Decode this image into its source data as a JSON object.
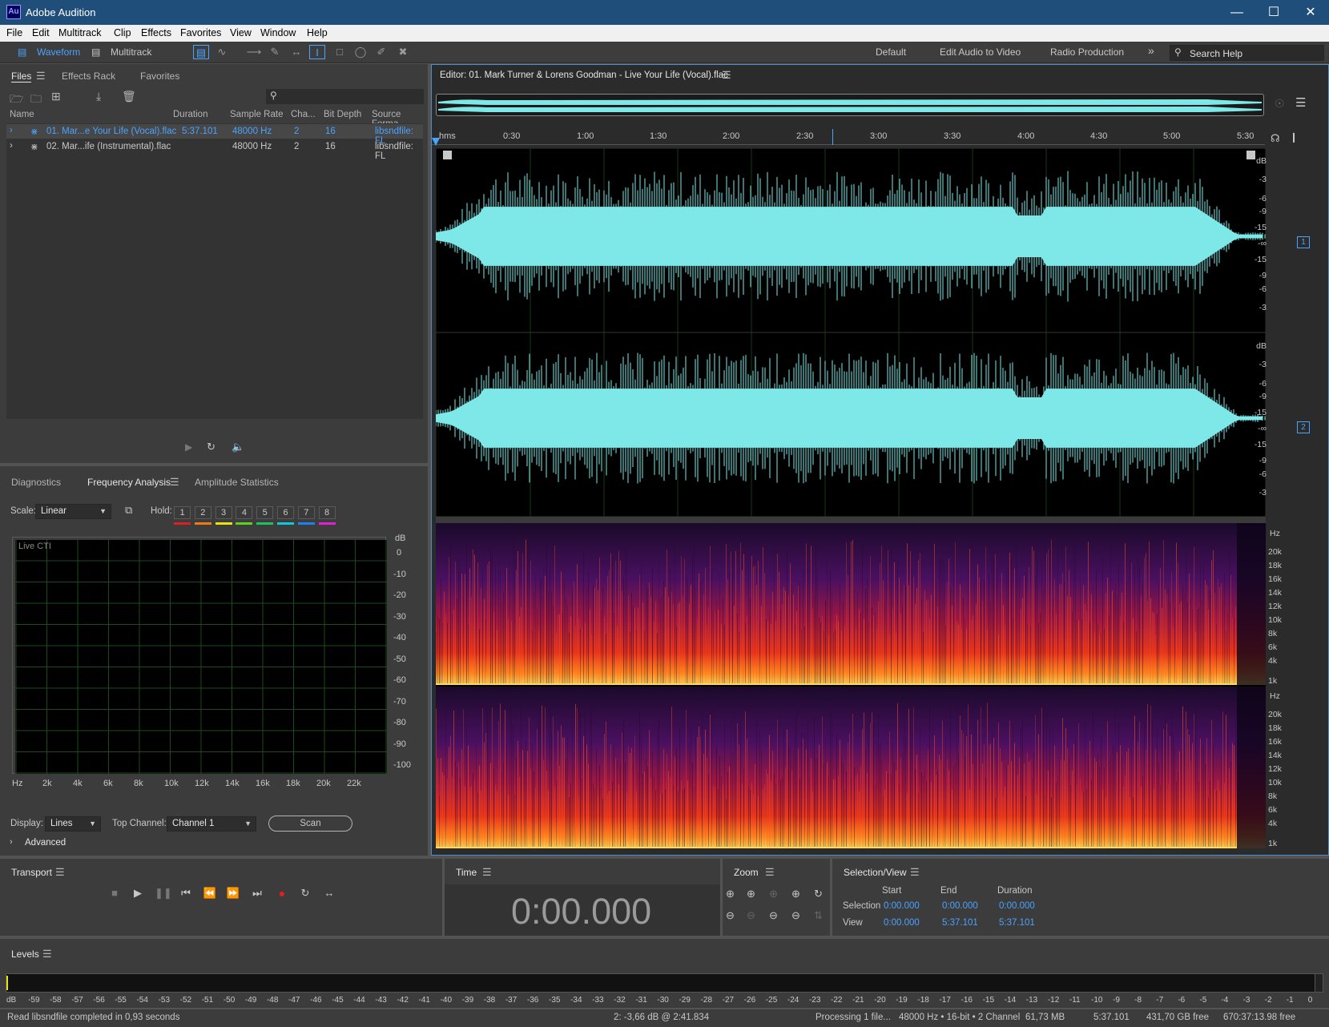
{
  "window": {
    "title": "Adobe Audition",
    "logo": "Au"
  },
  "menu": [
    "File",
    "Edit",
    "Multitrack",
    "Clip",
    "Effects",
    "Favorites",
    "View",
    "Window",
    "Help"
  ],
  "toolbar": {
    "waveform_label": "Waveform",
    "multitrack_label": "Multitrack",
    "workspaces": [
      "Default",
      "Edit Audio to Video",
      "Radio Production"
    ],
    "more": "»",
    "search_placeholder": "Search Help"
  },
  "files_panel": {
    "tabs": [
      "Files",
      "Effects Rack",
      "Favorites"
    ],
    "columns": [
      "Name",
      "Duration",
      "Sample Rate",
      "Cha...",
      "Bit Depth",
      "Source Forma"
    ],
    "rows": [
      {
        "name": "01. Mar...e Your Life (Vocal).flac",
        "duration": "5:37.101",
        "sample_rate": "48000 Hz",
        "channels": "2",
        "bit_depth": "16",
        "source": "libsndfile: FL",
        "selected": true
      },
      {
        "name": "02. Mar...ife (Instrumental).flac",
        "duration": "",
        "sample_rate": "48000 Hz",
        "channels": "2",
        "bit_depth": "16",
        "source": "libsndfile: FL",
        "selected": false
      }
    ]
  },
  "analysis_panel": {
    "tabs": [
      "Diagnostics",
      "Frequency Analysis",
      "Amplitude Statistics"
    ],
    "scale_label": "Scale:",
    "scale_value": "Linear",
    "hold_label": "Hold:",
    "hold_buttons": [
      "1",
      "2",
      "3",
      "4",
      "5",
      "6",
      "7",
      "8"
    ],
    "hold_colors": [
      "#e02020",
      "#f07a10",
      "#e8e010",
      "#60d020",
      "#20c060",
      "#10c8d8",
      "#2080f0",
      "#e020d8"
    ],
    "live_label": "Live CTI",
    "y_unit": "dB",
    "y_ticks": [
      "0",
      "-10",
      "-20",
      "-30",
      "-40",
      "-50",
      "-60",
      "-70",
      "-80",
      "-90",
      "-100"
    ],
    "x_ticks": [
      "Hz",
      "2k",
      "4k",
      "6k",
      "8k",
      "10k",
      "12k",
      "14k",
      "16k",
      "18k",
      "20k",
      "22k"
    ],
    "display_label": "Display:",
    "display_value": "Lines",
    "top_channel_label": "Top Channel:",
    "top_channel_value": "Channel 1",
    "scan_label": "Scan",
    "advanced_label": "Advanced"
  },
  "editor": {
    "title": "Editor: 01. Mark Turner & Lorens Goodman - Live Your Life (Vocal).flac",
    "timeline": [
      "hms",
      "0:30",
      "1:00",
      "1:30",
      "2:00",
      "2:30",
      "3:00",
      "3:30",
      "4:00",
      "4:30",
      "5:00",
      "5:30"
    ],
    "db_ticks_ch": [
      "dB",
      "-3",
      "-6",
      "-9",
      "-15",
      "-∞",
      "-15",
      "-9",
      "-6",
      "-3"
    ],
    "hz_ticks": [
      "Hz",
      "20k",
      "18k",
      "16k",
      "14k",
      "12k",
      "10k",
      "8k",
      "6k",
      "4k",
      "1k"
    ],
    "channels": [
      "1",
      "2"
    ],
    "waveform_color": "#7ee8e8",
    "accent": "#4aa3ff"
  },
  "transport": {
    "title": "Transport"
  },
  "time": {
    "title": "Time",
    "value": "0:00.000"
  },
  "zoom": {
    "title": "Zoom"
  },
  "selection": {
    "title": "Selection/View",
    "headers": [
      "Start",
      "End",
      "Duration"
    ],
    "rows": [
      {
        "label": "Selection",
        "start": "0:00.000",
        "end": "0:00.000",
        "duration": "0:00.000"
      },
      {
        "label": "View",
        "start": "0:00.000",
        "end": "5:37.101",
        "duration": "5:37.101"
      }
    ]
  },
  "levels": {
    "title": "Levels",
    "scale": [
      "dB",
      "-59",
      "-58",
      "-57",
      "-56",
      "-55",
      "-54",
      "-53",
      "-52",
      "-51",
      "-50",
      "-49",
      "-48",
      "-47",
      "-46",
      "-45",
      "-44",
      "-43",
      "-42",
      "-41",
      "-40",
      "-39",
      "-38",
      "-37",
      "-36",
      "-35",
      "-34",
      "-33",
      "-32",
      "-31",
      "-30",
      "-29",
      "-28",
      "-27",
      "-26",
      "-25",
      "-24",
      "-23",
      "-22",
      "-21",
      "-20",
      "-19",
      "-18",
      "-17",
      "-16",
      "-15",
      "-14",
      "-13",
      "-12",
      "-11",
      "-10",
      "-9",
      "-8",
      "-7",
      "-6",
      "-5",
      "-4",
      "-3",
      "-2",
      "-1",
      "0"
    ]
  },
  "status": {
    "message": "Read libsndfile completed in 0,93 seconds",
    "cursor": "2: -3,66 dB @ 2:41.834",
    "processing": "Processing 1 file...",
    "format": "48000 Hz • 16-bit • 2 Channel",
    "size": "61,73 MB",
    "duration": "5:37.101",
    "disk": "431,70 GB free",
    "free_time": "670:37:13.98 free"
  }
}
